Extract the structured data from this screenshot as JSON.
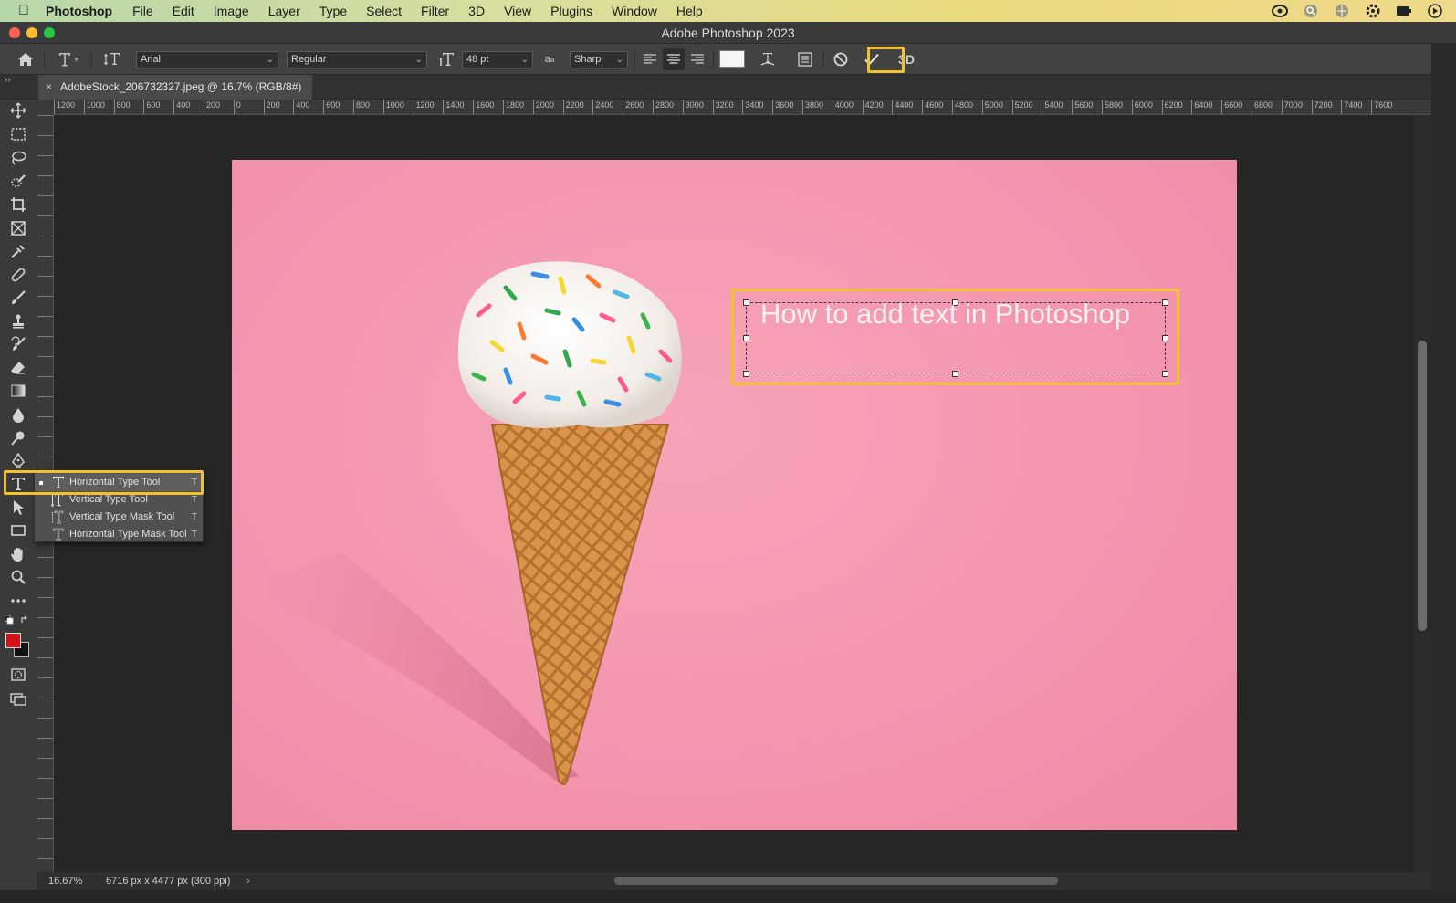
{
  "menubar": {
    "app_name": "Photoshop",
    "items": [
      "File",
      "Edit",
      "Image",
      "Layer",
      "Type",
      "Select",
      "Filter",
      "3D",
      "View",
      "Plugins",
      "Window",
      "Help"
    ]
  },
  "window": {
    "title": "Adobe Photoshop 2023"
  },
  "options_bar": {
    "font_family": "Arial",
    "font_style": "Regular",
    "font_size": "48 pt",
    "antialias": "Sharp",
    "color_swatch": "#f5f5f5",
    "three_d_label": "3D"
  },
  "document": {
    "tab_title": "AdobeStock_206732327.jpeg @ 16.7% (RGB/8#)",
    "close_glyph": "×"
  },
  "ruler": {
    "h_labels": [
      "1200",
      "1000",
      "800",
      "600",
      "400",
      "200",
      "0",
      "200",
      "400",
      "600",
      "800",
      "1000",
      "1200",
      "1400",
      "1600",
      "1800",
      "2000",
      "2200",
      "2400",
      "2600",
      "2800",
      "3000",
      "3200",
      "3400",
      "3600",
      "3800",
      "4000",
      "4200",
      "4400",
      "4600",
      "4800",
      "5000",
      "5200",
      "5400",
      "5600",
      "5800",
      "6000",
      "6200",
      "6400",
      "6600",
      "6800",
      "7000",
      "7200",
      "7400",
      "7600"
    ]
  },
  "type_flyout": {
    "items": [
      {
        "label": "Horizontal Type Tool",
        "key": "T"
      },
      {
        "label": "Vertical Type Tool",
        "key": "T"
      },
      {
        "label": "Vertical Type Mask Tool",
        "key": "T"
      },
      {
        "label": "Horizontal Type Mask Tool",
        "key": "T"
      }
    ]
  },
  "canvas": {
    "text": "How to add text in Photoshop"
  },
  "status": {
    "zoom": "16.67%",
    "doc_size": "6716 px x 4477 px (300 ppi)",
    "arrow": "›"
  },
  "colors": {
    "foreground": "#d0121b",
    "background": "#111111",
    "highlight": "#f2c12e"
  }
}
